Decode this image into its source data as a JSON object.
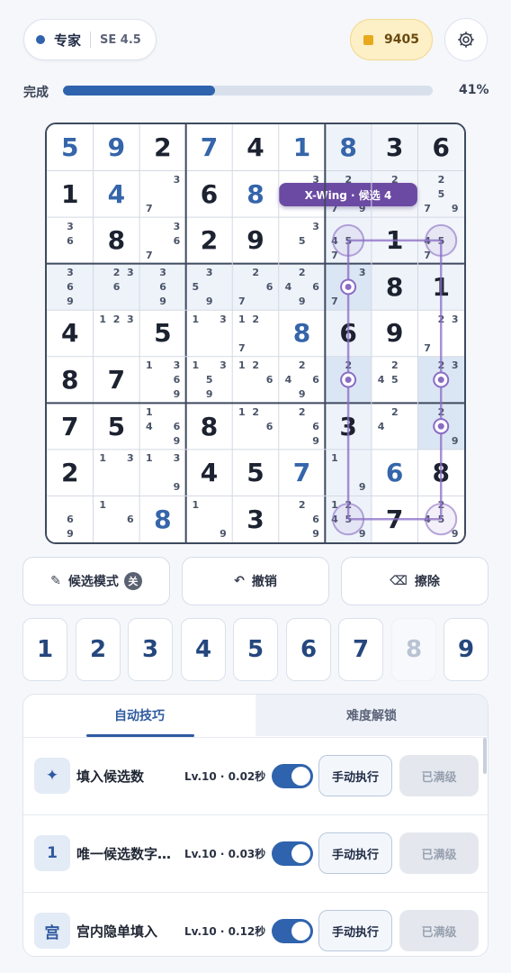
{
  "header": {
    "difficulty": "专家",
    "rating": "SE 4.5",
    "coins": "9405"
  },
  "progress": {
    "label": "完成",
    "percent_text": "41%",
    "fraction": 0.41
  },
  "board": {
    "cells": [
      [
        {
          "v": "5",
          "t": "user"
        },
        {
          "v": "9",
          "t": "user"
        },
        {
          "v": "2",
          "t": "given"
        },
        {
          "v": "7",
          "t": "user"
        },
        {
          "v": "4",
          "t": "given"
        },
        {
          "v": "1",
          "t": "user"
        },
        {
          "v": "8",
          "t": "user"
        },
        {
          "v": "3",
          "t": "given"
        },
        {
          "v": "6",
          "t": "given"
        }
      ],
      [
        {
          "v": "1",
          "t": "given"
        },
        {
          "v": "4",
          "t": "user"
        },
        {
          "c": [
            "",
            "",
            "3",
            "",
            "",
            "",
            "7",
            "",
            ""
          ]
        },
        {
          "v": "6",
          "t": "given"
        },
        {
          "v": "8",
          "t": "user"
        },
        {
          "c": [
            "",
            "",
            "3",
            "",
            "",
            "",
            "",
            "",
            ""
          ]
        },
        {
          "c": [
            "",
            "2",
            "",
            "",
            "",
            "",
            "7",
            "",
            "9"
          ]
        },
        {
          "c": [
            "",
            "2",
            "",
            "",
            "",
            "",
            "",
            "",
            ""
          ]
        },
        {
          "c": [
            "",
            "2",
            "",
            "",
            "5",
            "",
            "7",
            "",
            "9"
          ]
        }
      ],
      [
        {
          "c": [
            "",
            "3",
            "",
            "",
            "6",
            "",
            "",
            "",
            ""
          ]
        },
        {
          "v": "8",
          "t": "given"
        },
        {
          "c": [
            "",
            "",
            "3",
            "",
            "",
            "6",
            "7",
            "",
            ""
          ]
        },
        {
          "v": "2",
          "t": "given"
        },
        {
          "v": "9",
          "t": "given"
        },
        {
          "c": [
            "",
            "",
            "3",
            "",
            "5",
            "",
            "",
            "",
            ""
          ]
        },
        {
          "c": [
            "",
            "",
            "",
            "4",
            "5",
            "",
            "7",
            "",
            ""
          ]
        },
        {
          "v": "1",
          "t": "given"
        },
        {
          "c": [
            "",
            "",
            "",
            "4",
            "5",
            "",
            "7",
            "",
            ""
          ]
        }
      ],
      [
        {
          "c": [
            "",
            "3",
            "",
            "",
            "6",
            "",
            "",
            "9",
            ""
          ]
        },
        {
          "c": [
            "",
            "2",
            "3",
            "",
            "6",
            "",
            "",
            "",
            ""
          ]
        },
        {
          "c": [
            "",
            "3",
            "",
            "",
            "6",
            "",
            "",
            "9",
            ""
          ]
        },
        {
          "c": [
            "",
            "3",
            "",
            "5",
            "",
            "",
            "",
            "9",
            ""
          ]
        },
        {
          "c": [
            "",
            "2",
            "",
            "",
            "",
            "6",
            "7",
            "",
            ""
          ]
        },
        {
          "c": [
            "",
            "2",
            "",
            "4",
            "",
            "6",
            "",
            "9",
            ""
          ]
        },
        {
          "c": [
            "",
            "",
            "3",
            "",
            "",
            "",
            "7",
            "",
            ""
          ]
        },
        {
          "v": "8",
          "t": "given"
        },
        {
          "v": "1",
          "t": "given"
        }
      ],
      [
        {
          "v": "4",
          "t": "given"
        },
        {
          "c": [
            "1",
            "2",
            "3",
            "",
            "",
            "",
            "",
            "",
            ""
          ]
        },
        {
          "v": "5",
          "t": "given"
        },
        {
          "c": [
            "1",
            "",
            "3",
            "",
            "",
            "",
            "",
            "",
            ""
          ]
        },
        {
          "c": [
            "1",
            "2",
            "",
            "",
            "",
            "",
            "7",
            "",
            ""
          ]
        },
        {
          "v": "8",
          "t": "user"
        },
        {
          "v": "6",
          "t": "given"
        },
        {
          "v": "9",
          "t": "given"
        },
        {
          "c": [
            "",
            "2",
            "3",
            "",
            "",
            "",
            "7",
            "",
            ""
          ]
        }
      ],
      [
        {
          "v": "8",
          "t": "given"
        },
        {
          "v": "7",
          "t": "given"
        },
        {
          "c": [
            "1",
            "",
            "3",
            "",
            "",
            "6",
            "",
            "",
            "9"
          ]
        },
        {
          "c": [
            "1",
            "",
            "3",
            "",
            "5",
            "",
            "",
            "9",
            ""
          ]
        },
        {
          "c": [
            "1",
            "2",
            "",
            "",
            "",
            "6",
            "",
            "",
            ""
          ]
        },
        {
          "c": [
            "",
            "2",
            "",
            "4",
            "",
            "6",
            "",
            "9",
            ""
          ]
        },
        {
          "c": [
            "",
            "2",
            "",
            "",
            "",
            "",
            "",
            "",
            ""
          ]
        },
        {
          "c": [
            "",
            "2",
            "",
            "4",
            "5",
            "",
            "",
            "",
            ""
          ]
        },
        {
          "c": [
            "",
            "2",
            "3",
            "",
            "",
            "",
            "",
            "",
            ""
          ]
        }
      ],
      [
        {
          "v": "7",
          "t": "given"
        },
        {
          "v": "5",
          "t": "given"
        },
        {
          "c": [
            "1",
            "",
            "",
            "4",
            "",
            "6",
            "",
            "",
            "9"
          ]
        },
        {
          "v": "8",
          "t": "given"
        },
        {
          "c": [
            "1",
            "2",
            "",
            "",
            "",
            "6",
            "",
            "",
            ""
          ]
        },
        {
          "c": [
            "",
            "2",
            "",
            "",
            "",
            "6",
            "",
            "",
            "9"
          ]
        },
        {
          "v": "3",
          "t": "given"
        },
        {
          "c": [
            "",
            "2",
            "",
            "4",
            "",
            "",
            "",
            "",
            ""
          ]
        },
        {
          "c": [
            "",
            "2",
            "",
            "",
            "",
            "",
            "",
            "",
            "9"
          ]
        }
      ],
      [
        {
          "v": "2",
          "t": "given"
        },
        {
          "c": [
            "1",
            "",
            "3",
            "",
            "",
            "",
            "",
            "",
            ""
          ]
        },
        {
          "c": [
            "1",
            "",
            "3",
            "",
            "",
            "",
            "",
            "",
            "9"
          ]
        },
        {
          "v": "4",
          "t": "given"
        },
        {
          "v": "5",
          "t": "given"
        },
        {
          "v": "7",
          "t": "user"
        },
        {
          "c": [
            "1",
            "",
            "",
            "",
            "",
            "",
            "",
            "",
            "9"
          ]
        },
        {
          "v": "6",
          "t": "user"
        },
        {
          "v": "8",
          "t": "given"
        }
      ],
      [
        {
          "c": [
            "",
            "",
            "",
            "",
            "6",
            "",
            "",
            "9",
            ""
          ]
        },
        {
          "c": [
            "1",
            "",
            "",
            "",
            "",
            "6",
            "",
            "",
            ""
          ]
        },
        {
          "v": "8",
          "t": "user"
        },
        {
          "c": [
            "1",
            "",
            "",
            "",
            "",
            "",
            "",
            "",
            "9"
          ]
        },
        {
          "v": "3",
          "t": "given"
        },
        {
          "c": [
            "",
            "2",
            "",
            "",
            "",
            "6",
            "",
            "",
            "9"
          ]
        },
        {
          "c": [
            "1",
            "2",
            "",
            "4",
            "5",
            "",
            "",
            "",
            "9"
          ]
        },
        {
          "v": "7",
          "t": "given"
        },
        {
          "c": [
            "",
            "2",
            "",
            "4",
            "5",
            "",
            "",
            "",
            "9"
          ]
        }
      ]
    ],
    "highlight_color": "#dbe6f4",
    "xwing_color": "#8a6cc4",
    "tooltip": "X-Wing · 候选 4"
  },
  "actions": {
    "candidate_mode": "候选模式",
    "candidate_state": "关",
    "undo": "撤销",
    "erase": "擦除"
  },
  "numpad": [
    "1",
    "2",
    "3",
    "4",
    "5",
    "6",
    "7",
    "8",
    "9"
  ],
  "panel": {
    "tabs": [
      "自动技巧",
      "难度解锁"
    ],
    "rows": [
      {
        "icon": "✦",
        "name": "填入候选数",
        "level": "Lv.10 · 0.02秒",
        "manual": "手动执行",
        "maxed": "已满级"
      },
      {
        "icon": "1",
        "name": "唯一候选数字填入",
        "level": "Lv.10 · 0.03秒",
        "manual": "手动执行",
        "maxed": "已满级"
      },
      {
        "icon": "宫",
        "name": "宫内隐单填入",
        "level": "Lv.10 · 0.12秒",
        "manual": "手动执行",
        "maxed": "已满级"
      }
    ]
  }
}
